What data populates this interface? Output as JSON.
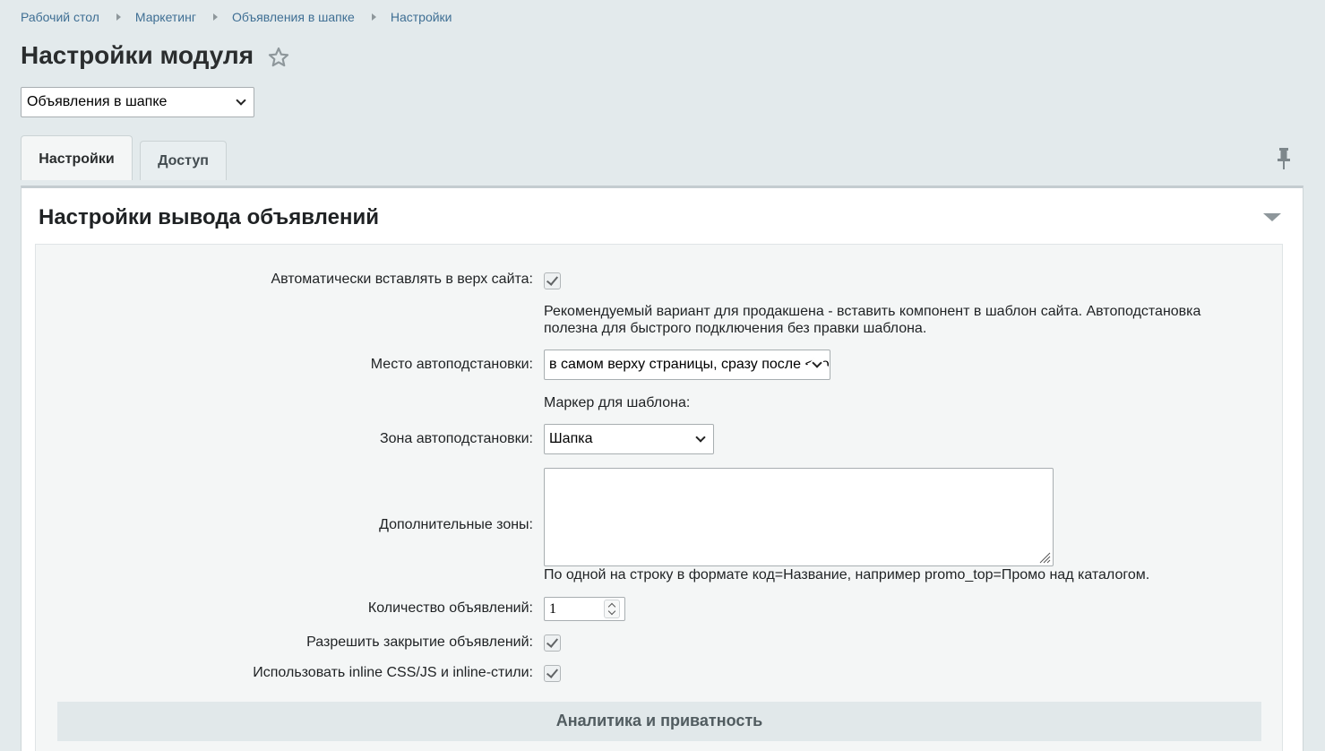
{
  "breadcrumbs": [
    "Рабочий стол",
    "Маркетинг",
    "Объявления в шапке",
    "Настройки"
  ],
  "page_title": "Настройки модуля",
  "module_select": {
    "value": "Объявления в шапке"
  },
  "tabs": [
    {
      "label": "Настройки",
      "active": true
    },
    {
      "label": "Доступ",
      "active": false
    }
  ],
  "section": {
    "title": "Настройки вывода объявлений",
    "fields": {
      "auto_insert": {
        "label": "Автоматически вставлять в верх сайта:",
        "checked": true
      },
      "auto_insert_hint": "Рекомендуемый вариант для продакшена - вставить компонент в шаблон сайта. Автоподстановка полезна для быстрого подключения без правки шаблона.",
      "auto_place": {
        "label": "Место автоподстановки:",
        "value": "в самом верху страницы, сразу после <body>"
      },
      "template_marker_label": "Маркер для шаблона:",
      "auto_zone": {
        "label": "Зона автоподстановки:",
        "value": "Шапка"
      },
      "extra_zones": {
        "label": "Дополнительные зоны:",
        "value": "",
        "hint": "По одной на строку в формате код=Название, например promo_top=Промо над каталогом."
      },
      "ads_count": {
        "label": "Количество объявлений:",
        "value": "1"
      },
      "allow_close": {
        "label": "Разрешить закрытие объявлений:",
        "checked": true
      },
      "inline_css": {
        "label": "Использовать inline CSS/JS и inline-стили:",
        "checked": true
      }
    },
    "subsection_title": "Аналитика и приватность"
  },
  "icons": {
    "star": "star-icon",
    "pin": "pin-icon",
    "collapse": "triangle-down-icon"
  }
}
